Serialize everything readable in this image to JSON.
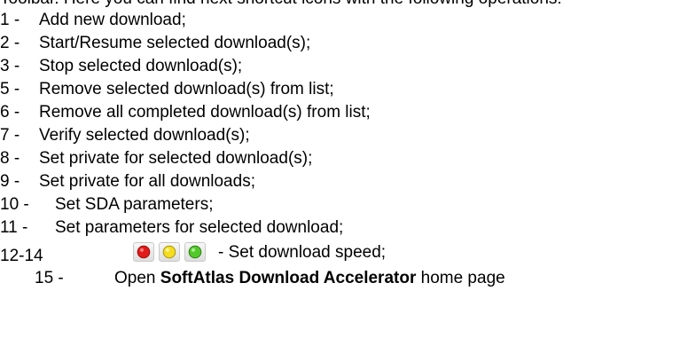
{
  "clipped_header": "Toolbar. Here you can find next shortcut icons with the following operations:",
  "items": [
    {
      "num": "1 -",
      "text": "Add new download;"
    },
    {
      "num": "2 -",
      "text": "Start/Resume selected download(s);"
    },
    {
      "num": "3 -",
      "text": "Stop selected download(s);"
    },
    {
      "num": "5 -",
      "text": "Remove selected download(s) from list;"
    },
    {
      "num": "6 -",
      "text": "Remove all completed download(s) from list;"
    },
    {
      "num": "7 -",
      "text": "Verify selected download(s);"
    },
    {
      "num": "8 -",
      "text": "Set private for selected download(s);"
    },
    {
      "num": "9 -",
      "text": "Set private for all downloads;"
    },
    {
      "num": "10 -",
      "text": "Set SDA parameters;"
    },
    {
      "num": "11 -",
      "text": "Set parameters for selected download;"
    }
  ],
  "speed_row": {
    "num": "12-14",
    "text": "- Set download speed;",
    "icons": [
      {
        "name": "red-speed-icon",
        "color": "#e21b1b"
      },
      {
        "name": "yellow-speed-icon",
        "color": "#f4dd1e"
      },
      {
        "name": "green-speed-icon",
        "color": "#52c92b"
      }
    ]
  },
  "home_row": {
    "num": "15 -",
    "prefix": "Open ",
    "bold": "SoftAtlas Download Accelerator",
    "suffix": " home page"
  }
}
